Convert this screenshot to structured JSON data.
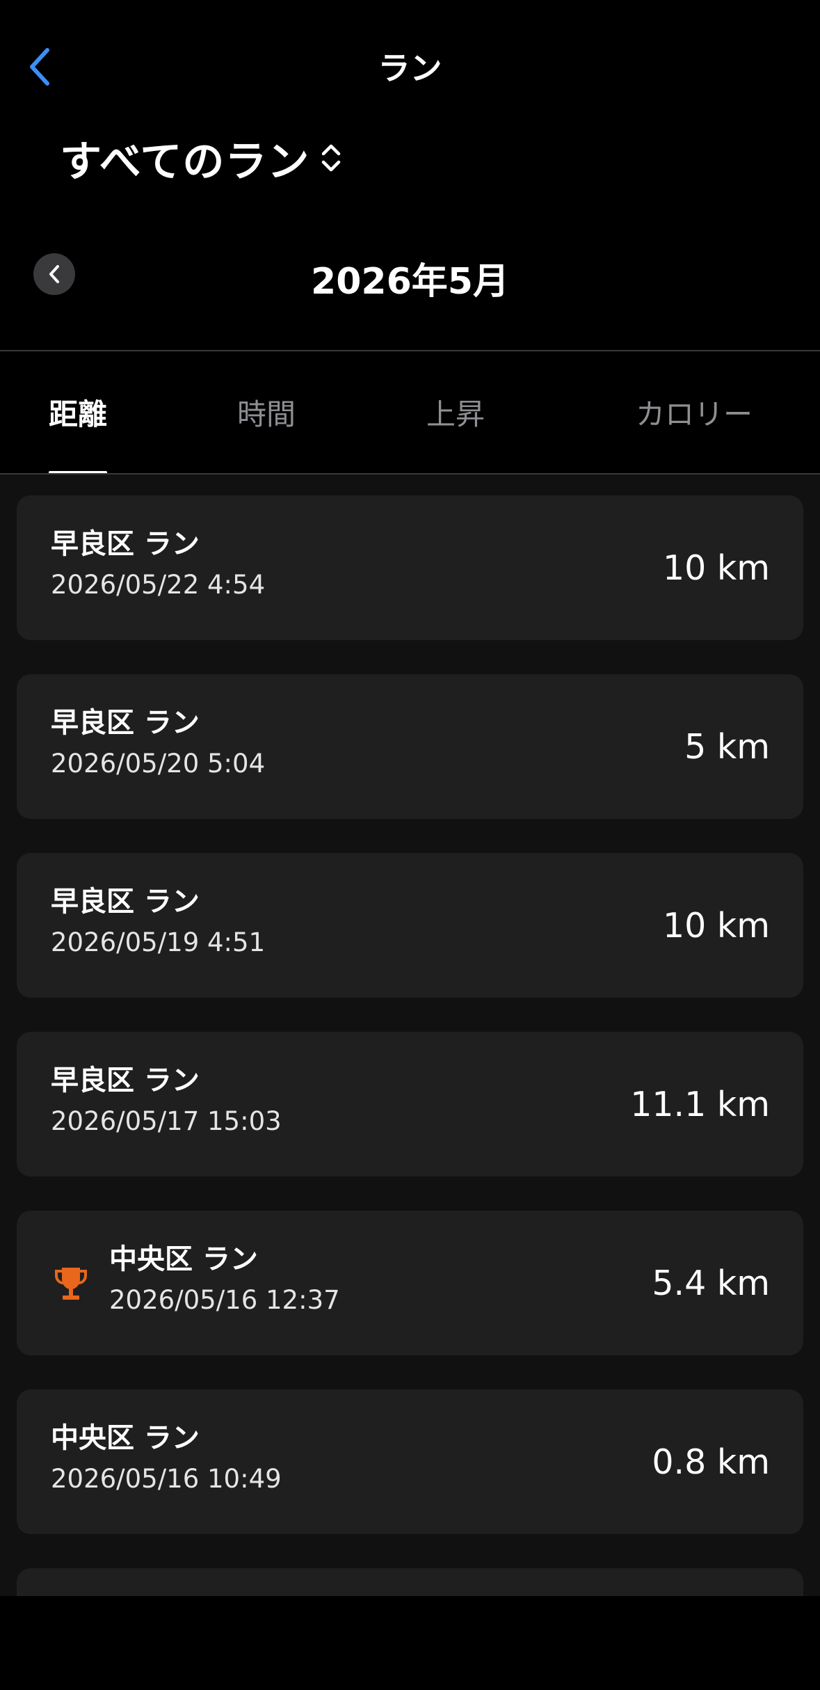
{
  "header": {
    "back_icon": "chevron-left-icon",
    "title": "ラン",
    "filter_label": "すべてのラン",
    "filter_icon": "up-down-chevron-icon"
  },
  "month_nav": {
    "prev_icon": "chevron-left-icon",
    "label": "2026年5月"
  },
  "tabs": [
    {
      "label": "距離",
      "active": true
    },
    {
      "label": "時間",
      "active": false
    },
    {
      "label": "上昇",
      "active": false
    },
    {
      "label": "カロリー",
      "active": false
    }
  ],
  "runs": [
    {
      "title": "早良区 ラン",
      "date": "2026/05/22 4:54",
      "value": "10 km"
    },
    {
      "title": "早良区 ラン",
      "date": "2026/05/20 5:04",
      "value": "5 km"
    },
    {
      "title": "早良区 ラン",
      "date": "2026/05/19 4:51",
      "value": "10 km"
    },
    {
      "title": "早良区 ラン",
      "date": "2026/05/17 15:03",
      "value": "11.1 km"
    },
    {
      "title": "中央区 ラン",
      "date": "2026/05/16 12:37",
      "value": "5.4 km",
      "icon": "trophy-icon"
    },
    {
      "title": "中央区 ラン",
      "date": "2026/05/16 10:49",
      "value": "0.8 km"
    }
  ],
  "colors": {
    "accent_blue": "#3b8ff5",
    "trophy_orange": "#e8671c",
    "card_bg": "#1f1f1f",
    "list_bg": "#111111"
  }
}
